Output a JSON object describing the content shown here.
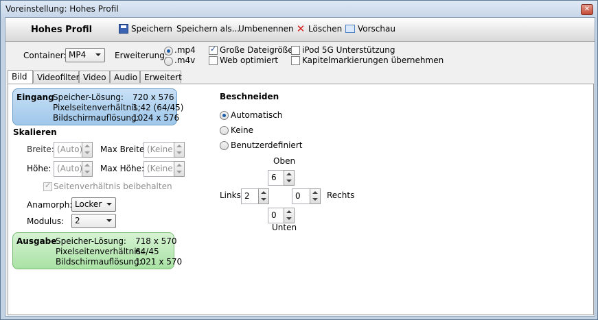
{
  "window": {
    "title": "Voreinstellung: Hohes Profil",
    "close": "✕"
  },
  "toolbar": {
    "profile_name": "Hohes Profil",
    "save_label": "Speichern",
    "save_as_label": "Speichern als...",
    "rename_label": "Umbenennen",
    "delete_label": "Löschen",
    "preview_label": "Vorschau"
  },
  "container": {
    "label": "Container:",
    "value": "MP4"
  },
  "extension": {
    "label": "Erweiterung:",
    "options": [
      ".mp4",
      ".m4v"
    ],
    "selected": ".mp4"
  },
  "options": {
    "large_file": {
      "label": "Große Dateigröße",
      "checked": true
    },
    "web_optimized": {
      "label": "Web optimiert",
      "checked": false
    },
    "ipod": {
      "label": "iPod 5G Unterstützung",
      "checked": false
    },
    "chapters": {
      "label": "Kapitelmarkierungen übernehmen",
      "checked": false
    }
  },
  "tabs": [
    "Bild",
    "Videofilter",
    "Video",
    "Audio",
    "Erweitert"
  ],
  "active_tab": "Bild",
  "input": {
    "header": "Eingang",
    "rows": [
      {
        "key": "Speicher-Lösung:",
        "value": "720 x 576"
      },
      {
        "key": "Pixelseitenverhältnis:",
        "value": "1,42 (64/45)"
      },
      {
        "key": "Bildschirmauflösung:",
        "value": "1024 x 576"
      }
    ]
  },
  "scaling": {
    "header": "Skalieren",
    "width_label": "Breite:",
    "width_value": "(Auto)",
    "max_width_label": "Max Breite:",
    "max_width_value": "(Keine)",
    "height_label": "Höhe:",
    "height_value": "(Auto)",
    "max_height_label": "Max Höhe:",
    "max_height_value": "(Keine)",
    "keep_aspect_label": "Seitenverhältnis beibehalten",
    "anamorphic_label": "Anamorph:",
    "anamorphic_value": "Locker",
    "modulus_label": "Modulus:",
    "modulus_value": "2"
  },
  "output": {
    "header": "Ausgabe",
    "rows": [
      {
        "key": "Speicher-Lösung:",
        "value": "718 x 570"
      },
      {
        "key": "Pixelseitenverhältnis:",
        "value": "64/45"
      },
      {
        "key": "Bildschirmauflösung:",
        "value": "1021 x 570"
      }
    ]
  },
  "crop": {
    "header": "Beschneiden",
    "modes": [
      "Automatisch",
      "Keine",
      "Benutzerdefiniert"
    ],
    "selected": "Automatisch",
    "top_label": "Oben",
    "top_value": "6",
    "left_label": "Links",
    "left_value": "2",
    "right_label": "Rechts",
    "right_value": "0",
    "bottom_label": "Unten",
    "bottom_value": "0"
  }
}
